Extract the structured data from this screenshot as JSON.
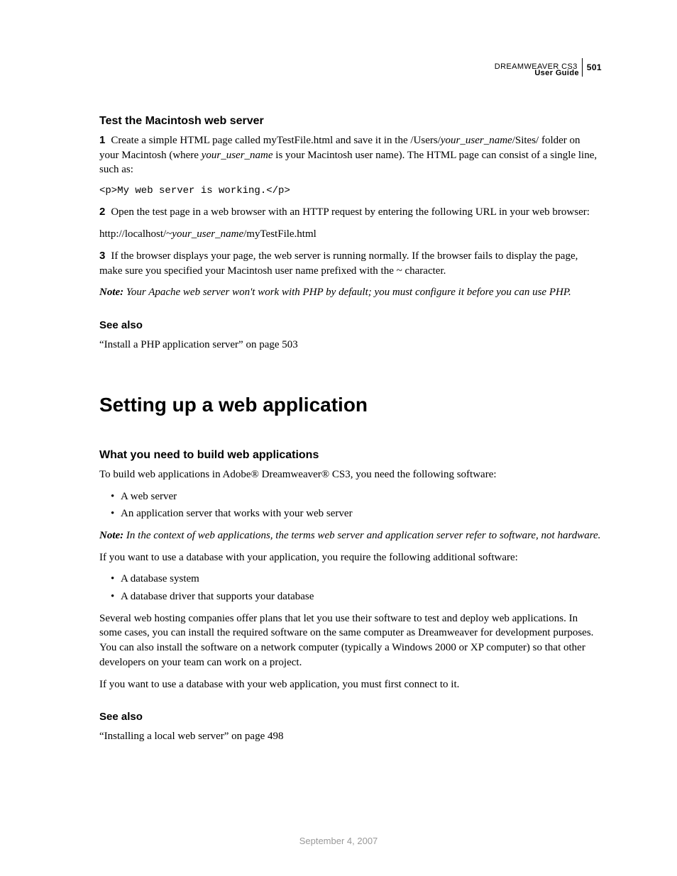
{
  "header": {
    "product": "DREAMWEAVER CS3",
    "page_number": "501",
    "guide": "User Guide"
  },
  "section1": {
    "heading": "Test the Macintosh web server",
    "step1_num": "1",
    "step1_a": "Create a simple HTML page called myTestFile.html and save it in the /Users/",
    "step1_b": "your_user_name",
    "step1_c": "/Sites/ folder on your Macintosh (where ",
    "step1_d": "your_user_name",
    "step1_e": " is your Macintosh user name). The HTML page can consist of a single line, such as:",
    "code": "<p>My web server is working.</p>",
    "step2_num": "2",
    "step2": "Open the test page in a web browser with an HTTP request by entering the following URL in your web browser:",
    "url_a": "http://localhost/~",
    "url_b": "your_user_name",
    "url_c": "/myTestFile.html",
    "step3_num": "3",
    "step3": "If the browser displays your page, the web server is running normally. If the browser fails to display the page, make sure you specified your Macintosh user name prefixed with the ~ character.",
    "note_label": "Note:",
    "note": " Your Apache web server won't work with PHP by default; you must configure it before you can use PHP.",
    "see_also": "See also",
    "see_also_link": "“Install a PHP application server” on page 503"
  },
  "section2": {
    "heading": "Setting up a web application",
    "subheading": "What you need to build web applications",
    "intro": "To build web applications in Adobe® Dreamweaver® CS3, you need the following software:",
    "bullets1": {
      "b1": "A web server",
      "b2": "An application server that works with your web server"
    },
    "note_label": "Note:",
    "note": " In the context of web applications, the terms web server and application server refer to software, not hardware.",
    "db_intro": "If you want to use a database with your application, you require the following additional software:",
    "bullets2": {
      "b1": "A database system",
      "b2": "A database driver that supports your database"
    },
    "para1": "Several web hosting companies offer plans that let you use their software to test and deploy web applications. In some cases, you can install the required software on the same computer as Dreamweaver for development purposes. You can also install the software on a network computer (typically a Windows 2000 or XP computer) so that other developers on your team can work on a project.",
    "para2": "If you want to use a database with your web application, you must first connect to it.",
    "see_also": "See also",
    "see_also_link": "“Installing a local web server” on page 498"
  },
  "footer": {
    "date": "September 4, 2007"
  }
}
